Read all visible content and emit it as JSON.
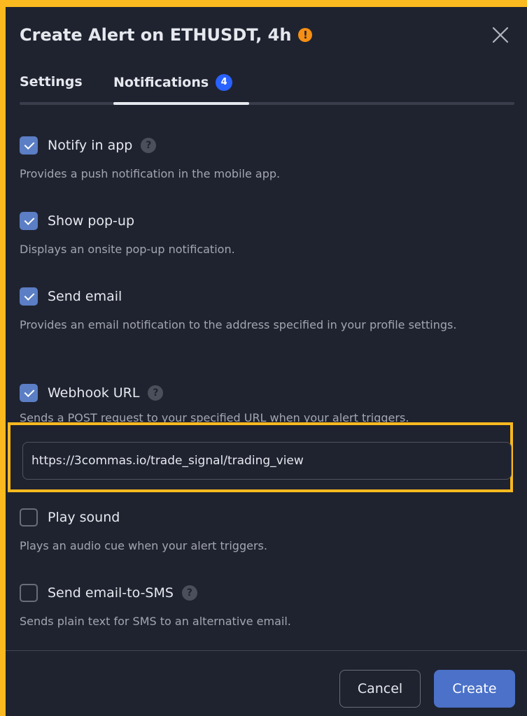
{
  "dialog": {
    "title": "Create Alert on ETHUSDT, 4h",
    "warning_icon": "exclamation-icon",
    "warning_glyph": "!",
    "close_icon": "close-icon"
  },
  "tabs": [
    {
      "label": "Settings",
      "active": false
    },
    {
      "label": "Notifications",
      "active": true,
      "badge": "4"
    }
  ],
  "options": [
    {
      "label": "Notify in app",
      "checked": true,
      "help": "?",
      "description": "Provides a push notification in the mobile app."
    },
    {
      "label": "Show pop-up",
      "checked": true,
      "description": "Displays an onsite pop-up notification."
    },
    {
      "label": "Send email",
      "checked": true,
      "description": "Provides an email notification to the address specified in your profile settings."
    },
    {
      "label": "Webhook URL",
      "checked": true,
      "help": "?",
      "description": "Sends a POST request to your specified URL when your alert triggers."
    },
    {
      "label": "Play sound",
      "checked": false,
      "description": "Plays an audio cue when your alert triggers."
    },
    {
      "label": "Send email-to-SMS",
      "checked": false,
      "help": "?",
      "description": "Sends plain text for SMS to an alternative email."
    }
  ],
  "webhook": {
    "url": "https://3commas.io/trade_signal/trading_view"
  },
  "footer": {
    "cancel_label": "Cancel",
    "create_label": "Create"
  },
  "colors": {
    "highlight": "#f9b91f",
    "accent": "#2962ff",
    "checkbox_checked": "#5b7ec5",
    "primary_button": "#4b71c9",
    "warning": "#f68f13"
  }
}
